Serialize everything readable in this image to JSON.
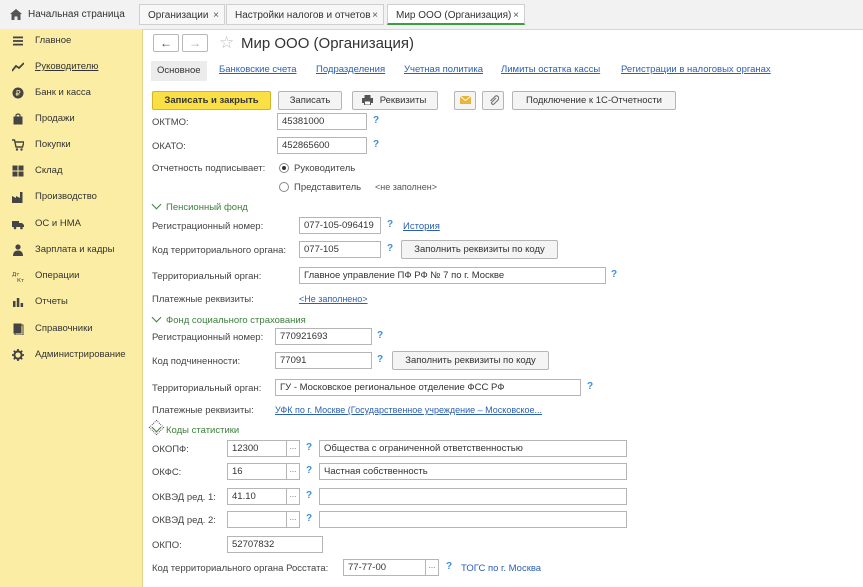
{
  "tabs": {
    "home": "Начальная страница",
    "items": [
      {
        "label": "Организации",
        "close": "×"
      },
      {
        "label": "Настройки налогов и отчетов",
        "close": "×"
      },
      {
        "label": "Мир ООО (Организация)",
        "close": "×"
      }
    ]
  },
  "sidebar": {
    "items": [
      {
        "label": "Главное",
        "icon": "menu-icon"
      },
      {
        "label": "Руководителю",
        "icon": "trend-icon"
      },
      {
        "label": "Банк и касса",
        "icon": "bank-icon"
      },
      {
        "label": "Продажи",
        "icon": "bag-icon"
      },
      {
        "label": "Покупки",
        "icon": "cart-icon"
      },
      {
        "label": "Склад",
        "icon": "warehouse-icon"
      },
      {
        "label": "Производство",
        "icon": "factory-icon"
      },
      {
        "label": "ОС и НМА",
        "icon": "truck-icon"
      },
      {
        "label": "Зарплата и кадры",
        "icon": "person-icon"
      },
      {
        "label": "Операции",
        "icon": "operations-icon"
      },
      {
        "label": "Отчеты",
        "icon": "chart-icon"
      },
      {
        "label": "Справочники",
        "icon": "book-icon"
      },
      {
        "label": "Администрирование",
        "icon": "gear-icon"
      }
    ]
  },
  "header": {
    "back": "←",
    "forward": "→",
    "star": "☆",
    "title": "Мир ООО (Организация)"
  },
  "section_tabs": {
    "current": "Основное",
    "links": [
      "Банковские счета",
      "Подразделения",
      "Учетная политика",
      "Лимиты остатка кассы",
      "Регистрации в налоговых органах"
    ]
  },
  "toolbar": {
    "save_close": "Записать и закрыть",
    "save": "Записать",
    "requisites": "Реквизиты",
    "connect": "Подключение к 1С-Отчетности"
  },
  "form": {
    "oktmo_label": "ОКТМО:",
    "oktmo_value": "45381000",
    "okato_label": "ОКАТО:",
    "okato_value": "452865600",
    "signer_label": "Отчетность подписывает:",
    "signer_head": "Руководитель",
    "signer_rep": "Представитель",
    "signer_rep_value": "<не заполнен>",
    "help": "?",
    "pension": {
      "title": "Пенсионный фонд",
      "reg_label": "Регистрационный номер:",
      "reg_value": "077-105-096419",
      "history": "История",
      "terr_code_label": "Код территориального органа:",
      "terr_code_value": "077-105",
      "fill_button": "Заполнить реквизиты по коду",
      "terr_label": "Территориальный орган:",
      "terr_value": "Главное управление ПФ РФ № 7 по г. Москве",
      "pay_label": "Платежные реквизиты:",
      "pay_value": "<Не заполнено>"
    },
    "fss": {
      "title": "Фонд социального страхования",
      "reg_label": "Регистрационный номер:",
      "reg_value": "770921693",
      "sub_label": "Код подчиненности:",
      "sub_value": "77091",
      "fill_button": "Заполнить реквизиты по коду",
      "terr_label": "Территориальный орган:",
      "terr_value": "ГУ - Московское региональное отделение ФСС РФ",
      "pay_label": "Платежные реквизиты:",
      "pay_value": "УФК по г. Москве (Государственное учреждение – Московское..."
    },
    "stats": {
      "title": "Коды статистики",
      "okopf_label": "ОКОПФ:",
      "okopf_code": "12300",
      "okopf_name": "Общества с ограниченной ответственностью",
      "okfs_label": "ОКФС:",
      "okfs_code": "16",
      "okfs_name": "Частная собственность",
      "okved1_label": "ОКВЭД ред. 1:",
      "okved1_code": "41.10",
      "okved2_label": "ОКВЭД ред. 2:",
      "okved2_code": "",
      "okpo_label": "ОКПО:",
      "okpo_value": "52707832",
      "rosstat_label": "Код территориального органа Росстата:",
      "rosstat_value": "77-77-00",
      "rosstat_name": "ТОГС по г. Москва",
      "ellipsis": "..."
    }
  },
  "colors": {
    "sidebar_bg": "#fbeea4",
    "primary_button": "#fbe045",
    "link": "#2a5fb3",
    "group_title": "#3d7f3d",
    "active_tab_underline": "#3d9e3d"
  }
}
